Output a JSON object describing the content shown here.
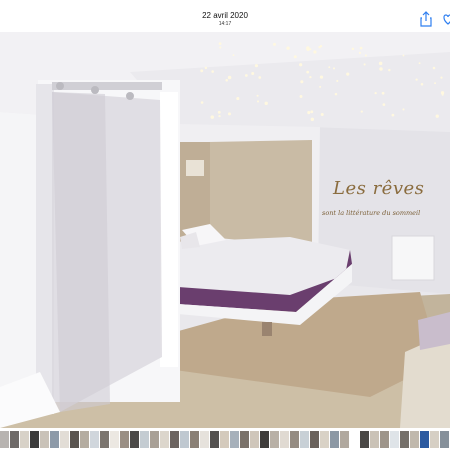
{
  "header": {
    "date": "22 avril 2020",
    "time": "14:17",
    "share_icon": "share-icon",
    "favorite_icon": "heart-icon",
    "accent": "#2f7ff0"
  },
  "photo": {
    "wall_text_title": "Les rêves",
    "wall_text_subtitle": "sont la littérature du sommeil"
  },
  "thumbnails": {
    "colors": [
      "#b7b3b0",
      "#6e6a68",
      "#d8d2c8",
      "#3c3c3c",
      "#c9c2b8",
      "#8d9aa8",
      "#e2ddd6",
      "#5a5550",
      "#b4aca0",
      "#d0d6dc",
      "#7c7670",
      "#ece8e2",
      "#9a8f84",
      "#4c4a48",
      "#c4ccd2",
      "#a8a096",
      "#dcd6cc",
      "#6c6460",
      "#bfc8d0",
      "#8a8076",
      "#e6e2dc",
      "#545250",
      "#d4cabc",
      "#a6b0ba",
      "#7a726a",
      "#cfc6ba",
      "#3f3d3b",
      "#b8b0a6",
      "#e0dad2",
      "#958c82",
      "#c8d0d6",
      "#6a625c",
      "#d9d2c6",
      "#8c98a4",
      "#b0a89e",
      "#ffffff",
      "#4a4846",
      "#cac2b6",
      "#9e958a",
      "#dfe4e8",
      "#75706a",
      "#c0b8ac",
      "#2c5aa0",
      "#d6cfc4",
      "#86909a",
      "#a29a90",
      "#ebe6df",
      "#5e5a56"
    ]
  }
}
